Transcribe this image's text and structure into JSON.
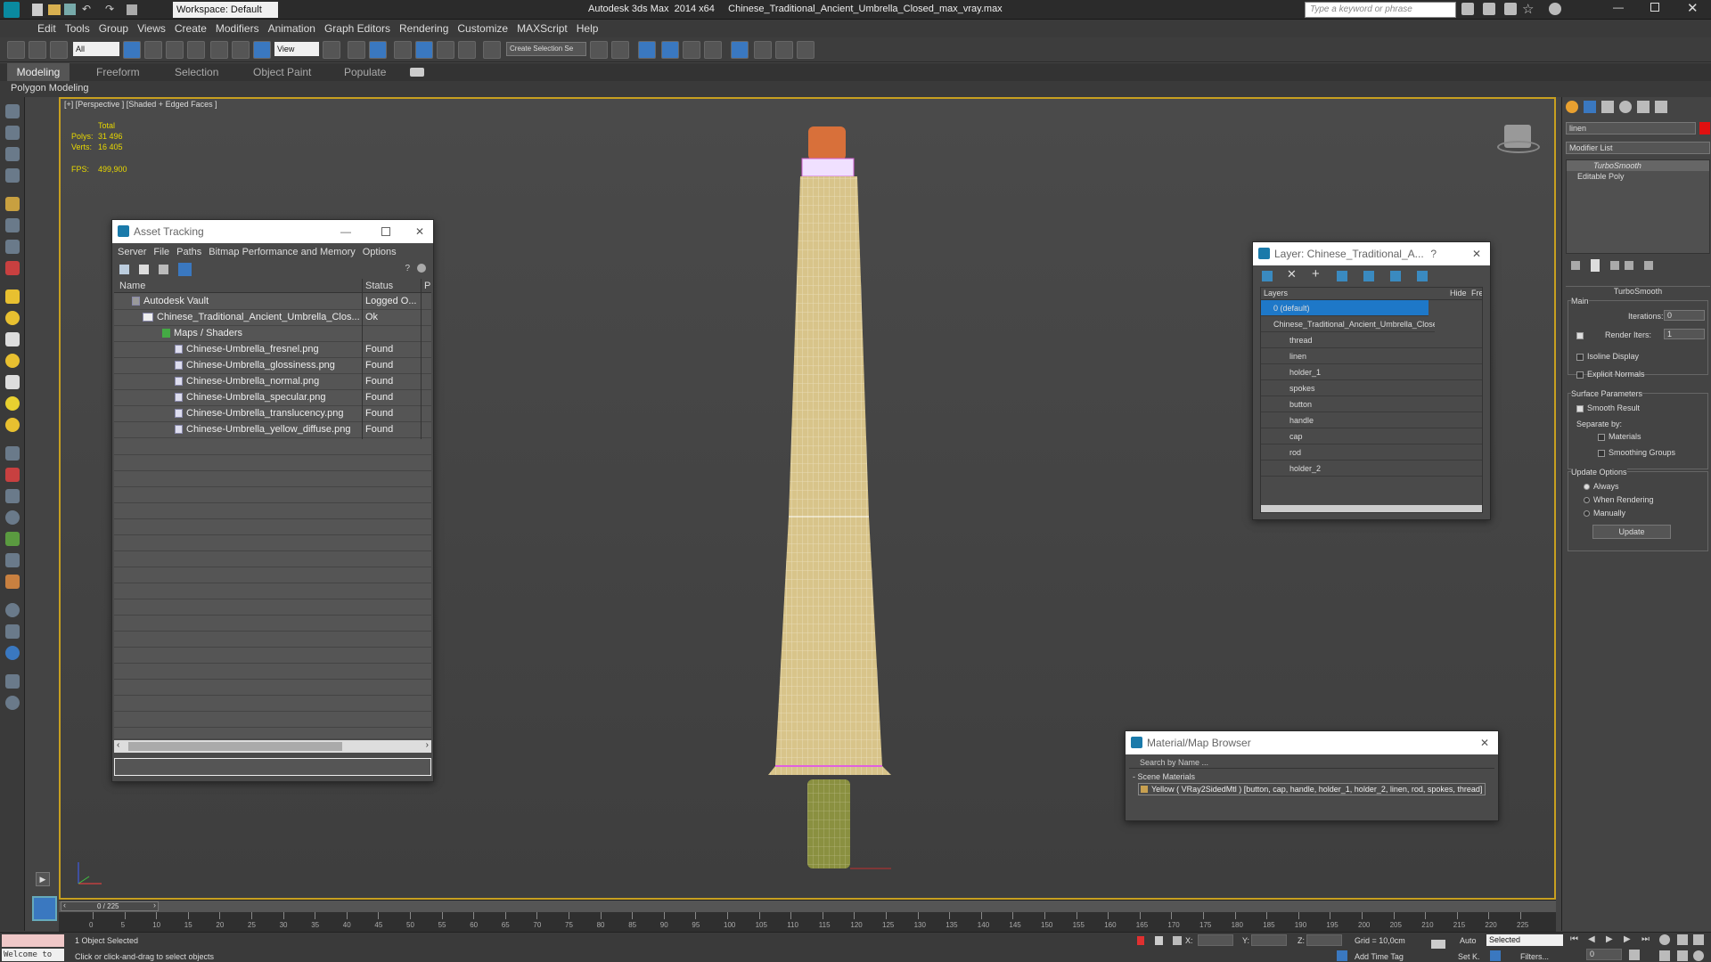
{
  "titlebar": {
    "workspace": "Workspace: Default",
    "title": "Autodesk 3ds Max  2014 x64     Chinese_Traditional_Ancient_Umbrella_Closed_max_vray.max",
    "search_placeholder": "Type a keyword or phrase"
  },
  "menu": [
    "Edit",
    "Tools",
    "Group",
    "Views",
    "Create",
    "Modifiers",
    "Animation",
    "Graph Editors",
    "Rendering",
    "Customize",
    "MAXScript",
    "Help"
  ],
  "toolbar": {
    "filter": "All",
    "ref_coord": "View",
    "named_sel": "Create Selection Se"
  },
  "ribbon": {
    "tabs": [
      "Modeling",
      "Freeform",
      "Selection",
      "Object Paint",
      "Populate"
    ],
    "sub": "Polygon Modeling"
  },
  "viewport": {
    "label": "[+] [Perspective ] [Shaded + Edged Faces ]",
    "total": "Total",
    "polys_label": "Polys:",
    "polys": "31 496",
    "verts_label": "Verts:",
    "verts": "16 405",
    "fps_label": "FPS:",
    "fps": "499,900"
  },
  "asset_tracking": {
    "title": "Asset Tracking",
    "menu": [
      "Server",
      "File",
      "Paths",
      "Bitmap Performance and Memory",
      "Options"
    ],
    "col_name": "Name",
    "col_status": "Status",
    "col_p": "Pr",
    "rows": [
      {
        "name": "Autodesk Vault",
        "status": "Logged O..."
      },
      {
        "name": "Chinese_Traditional_Ancient_Umbrella_Clos...",
        "status": "Ok"
      },
      {
        "name": "Maps / Shaders",
        "status": ""
      },
      {
        "name": "Chinese-Umbrella_fresnel.png",
        "status": "Found"
      },
      {
        "name": "Chinese-Umbrella_glossiness.png",
        "status": "Found"
      },
      {
        "name": "Chinese-Umbrella_normal.png",
        "status": "Found"
      },
      {
        "name": "Chinese-Umbrella_specular.png",
        "status": "Found"
      },
      {
        "name": "Chinese-Umbrella_translucency.png",
        "status": "Found"
      },
      {
        "name": "Chinese-Umbrella_yellow_diffuse.png",
        "status": "Found"
      }
    ]
  },
  "layer": {
    "title": "Layer: Chinese_Traditional_A...",
    "help": "?",
    "col_layers": "Layers",
    "col_hide": "Hide",
    "col_freeze": "Free",
    "rows": [
      "0 (default)",
      "Chinese_Traditional_Ancient_Umbrella_Close",
      "thread",
      "linen",
      "holder_1",
      "spokes",
      "button",
      "handle",
      "cap",
      "rod",
      "holder_2"
    ]
  },
  "material_browser": {
    "title": "Material/Map Browser",
    "search": "Search by Name ...",
    "section": "- Scene Materials",
    "material": "Yellow  ( VRay2SidedMtl )  [button, cap, handle, holder_1, holder_2, linen, rod, spokes, thread]"
  },
  "command_panel": {
    "name": "linen",
    "modifier_list": "Modifier List",
    "stack": [
      "TurboSmooth",
      "Editable Poly"
    ],
    "rollout": "TurboSmooth",
    "main": "Main",
    "iterations_label": "Iterations:",
    "iterations": "0",
    "render_iters_label": "Render Iters:",
    "render_iters": "1",
    "isoline": "Isoline Display",
    "explicit": "Explicit Normals",
    "surface": "Surface Parameters",
    "smooth": "Smooth Result",
    "separate": "Separate by:",
    "materials": "Materials",
    "smoothing": "Smoothing Groups",
    "update_opts": "Update Options",
    "always": "Always",
    "when_rendering": "When Rendering",
    "manually": "Manually",
    "update_btn": "Update"
  },
  "timeline": {
    "frame": "0 / 225",
    "ticks": [
      "0",
      "5",
      "10",
      "15",
      "20",
      "25",
      "30",
      "35",
      "40",
      "45",
      "50",
      "55",
      "60",
      "65",
      "70",
      "75",
      "80",
      "85",
      "90",
      "95",
      "100",
      "105",
      "110",
      "115",
      "120",
      "125",
      "130",
      "135",
      "140",
      "145",
      "150",
      "155",
      "160",
      "165",
      "170",
      "175",
      "180",
      "185",
      "190",
      "195",
      "200",
      "205",
      "210",
      "215",
      "220",
      "225"
    ]
  },
  "status": {
    "selected": "1 Object Selected",
    "prompt": "Click or click-and-drag to select objects",
    "welcome": "Welcome to",
    "x": "X:",
    "y": "Y:",
    "z": "Z:",
    "grid": "Grid = 10,0cm",
    "add_time_tag": "Add Time Tag",
    "auto": "Auto",
    "set_key": "Set K.",
    "key_filter": "Selected",
    "filters": "Filters...",
    "frame_field": "0"
  },
  "colors": {
    "accent": "#c8a020",
    "selection": "#1e78c8",
    "umbrella": "#e0cfa0"
  }
}
